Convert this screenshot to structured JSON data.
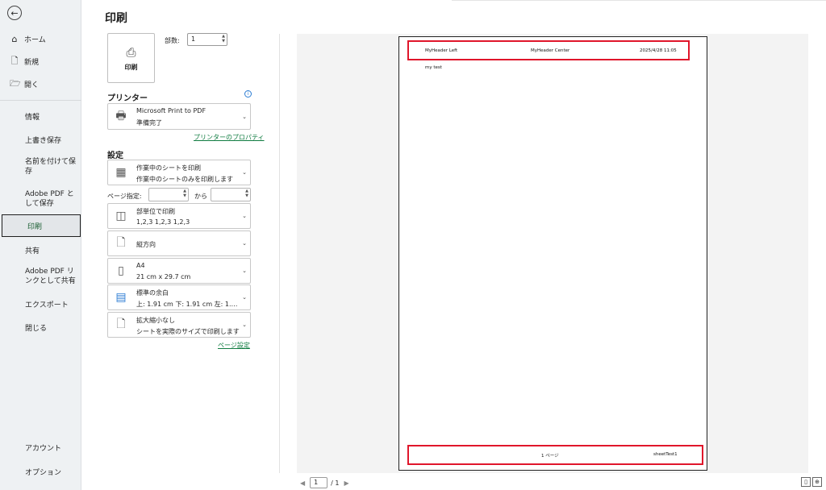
{
  "nav": {
    "back": "←",
    "home": "ホーム",
    "new": "新規",
    "open": "開く",
    "info": "情報",
    "save": "上書き保存",
    "save_as": "名前を付けて保存",
    "save_adobe": "Adobe PDF として保存",
    "print": "印刷",
    "share": "共有",
    "share_adobe": "Adobe PDF リンクとして共有",
    "export": "エクスポート",
    "close": "閉じる",
    "account": "アカウント",
    "options": "オプション"
  },
  "print": {
    "title": "印刷",
    "button_label": "印刷",
    "copies_label": "部数:",
    "copies_value": "1"
  },
  "printer": {
    "section": "プリンター",
    "info_icon": "i",
    "name": "Microsoft Print to PDF",
    "status": "準備完了",
    "properties_link": "プリンターのプロパティ"
  },
  "settings": {
    "section": "設定",
    "scope": {
      "l1": "作業中のシートを印刷",
      "l2": "作業中のシートのみを印刷します"
    },
    "pages_label": "ページ指定:",
    "pages_to": "から",
    "collate": {
      "l1": "部単位で印刷",
      "l2": "1,2,3    1,2,3    1,2,3"
    },
    "orientation": {
      "l1": "縦方向"
    },
    "paper": {
      "l1": "A4",
      "l2": "21 cm x 29.7 cm"
    },
    "margins": {
      "l1": "標準の余白",
      "l2": "上: 1.91 cm 下: 1.91 cm 左: 1.…"
    },
    "scaling": {
      "l1": "拡大縮小なし",
      "l2": "シートを実際のサイズで印刷します"
    },
    "page_setup_link": "ページ設定"
  },
  "preview": {
    "header_left": "MyHeader Left",
    "header_center": "MyHeader Center",
    "header_right": "2025/4/28 11:05",
    "body_text": "my test",
    "footer_center": "1 ページ",
    "footer_right": "sheetTest1",
    "current_page": "1",
    "total_pages": "/ 1"
  },
  "colors": {
    "accent": "#107c41",
    "highlight": "#e0162b"
  }
}
